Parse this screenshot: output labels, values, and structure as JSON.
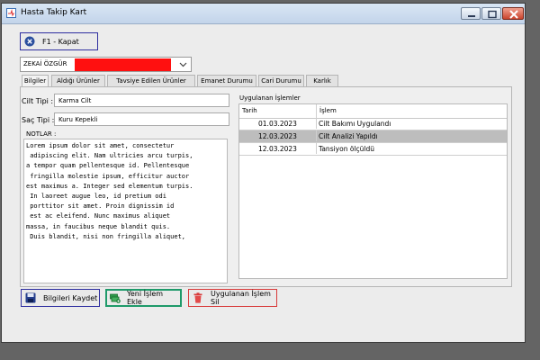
{
  "window": {
    "title": "Hasta Takip Kart"
  },
  "toolbar": {
    "close_label": "F1 - Kapat"
  },
  "customer": {
    "selected": "ZEKAİ ÖZGÜR"
  },
  "tabs": [
    "Bilgiler",
    "Aldığı Ürünler",
    "Tavsiye Edilen Ürünler",
    "Emanet Durumu",
    "Cari Durumu",
    "Karlık"
  ],
  "info": {
    "skin_label": "Cilt Tipi :",
    "skin_value": "Karma Cilt",
    "hair_label": "Saç Tipi :",
    "hair_value": "Kuru Kepekli",
    "notes_label": "NOTLAR :",
    "notes_lines": [
      "Lorem ipsum dolor sit amet, consectetur",
      " adipiscing elit. Nam ultricies arcu turpis,",
      "a tempor quam pellentesque id. Pellentesque",
      " fringilla molestie ipsum, efficitur auctor",
      "est maximus a. Integer sed elementum turpis.",
      " In laoreet augue leo, id pretium odi",
      " porttitor sit amet. Proin dignissim id",
      " est ac eleifend. Nunc maximus aliquet",
      "massa, in faucibus neque blandit quis.",
      " Duis blandit, nisi non fringilla aliquet,"
    ]
  },
  "procedures": {
    "title": "Uygulanan İşlemler",
    "columns": [
      "Tarih",
      "İşlem"
    ],
    "rows": [
      {
        "date": "01.03.2023",
        "name": "Cilt Bakımı Uygulandı",
        "selected": false
      },
      {
        "date": "12.03.2023",
        "name": "Cilt Analizi Yapıldı",
        "selected": true
      },
      {
        "date": "12.03.2023",
        "name": "Tansiyon ölçüldü",
        "selected": false
      }
    ]
  },
  "buttons": {
    "save": "Bilgileri Kaydet",
    "new_proc": "Yeni İşlem Ekle",
    "delete_proc": "Uygulanan İşlem Sil"
  },
  "colors": {
    "save_border": "#2f2fa0",
    "new_border": "#1f9a6a",
    "delete_border": "#d83a3a",
    "redaction": "#ff1010",
    "selected_row": "#bdbdbd"
  },
  "icons": {
    "close": "close-circle-icon",
    "save": "floppy-disk-icon",
    "new": "money-stack-icon",
    "delete": "trash-icon"
  }
}
